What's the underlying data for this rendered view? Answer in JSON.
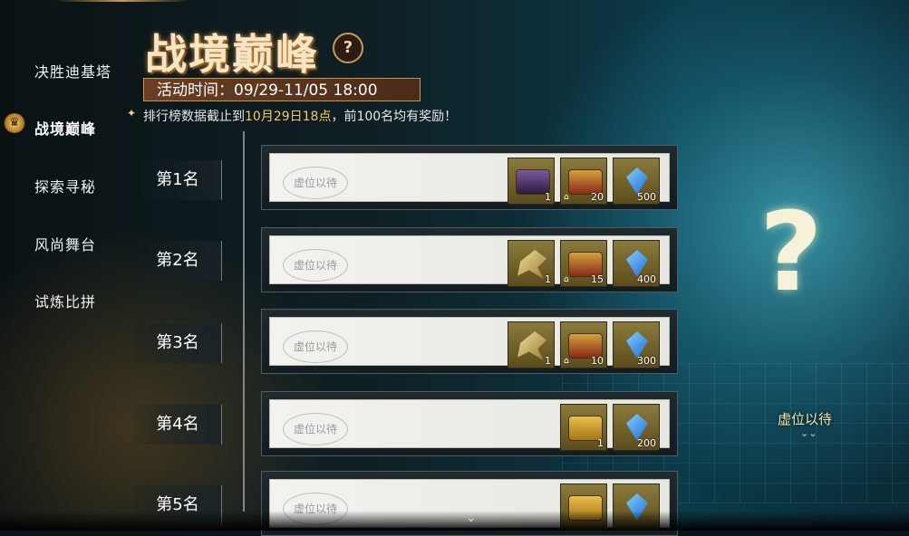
{
  "nav": {
    "items": [
      {
        "label": "决胜迪基塔",
        "active": false
      },
      {
        "label": "战境巅峰",
        "active": true
      },
      {
        "label": "探索寻秘",
        "active": false
      },
      {
        "label": "风尚舞台",
        "active": false
      },
      {
        "label": "试炼比拼",
        "active": false
      }
    ]
  },
  "header": {
    "title": "战境巅峰",
    "help": "?",
    "time": "活动时间：09/29-11/05 18:00",
    "notice_pre": "排行榜数据截止到",
    "notice_highlight": "10月29日18点",
    "notice_post": "，前100名均有奖励！"
  },
  "rankings": [
    {
      "label": "第1名",
      "placeholder": "虚位以待",
      "rewards": [
        {
          "icon": "dark-chest-icon",
          "qty": "1"
        },
        {
          "icon": "gold-chest-icon",
          "qty": "20"
        },
        {
          "icon": "blue-gem-icon",
          "qty": "500"
        }
      ]
    },
    {
      "label": "第2名",
      "placeholder": "虚位以待",
      "rewards": [
        {
          "icon": "weapon-icon",
          "qty": "1"
        },
        {
          "icon": "gold-chest-icon",
          "qty": "15"
        },
        {
          "icon": "blue-gem-icon",
          "qty": "400"
        }
      ]
    },
    {
      "label": "第3名",
      "placeholder": "虚位以待",
      "rewards": [
        {
          "icon": "weapon-icon",
          "qty": "1"
        },
        {
          "icon": "gold-chest-icon",
          "qty": "10"
        },
        {
          "icon": "blue-gem-icon",
          "qty": "300"
        }
      ]
    },
    {
      "label": "第4名",
      "placeholder": "虚位以待",
      "rewards": [
        {
          "icon": "treasure-chest-icon",
          "qty": "1"
        },
        {
          "icon": "blue-gem-icon",
          "qty": "200"
        }
      ]
    },
    {
      "label": "第5名",
      "placeholder": "虚位以待",
      "rewards": [
        {
          "icon": "treasure-chest-icon",
          "qty": ""
        },
        {
          "icon": "blue-gem-icon",
          "qty": ""
        }
      ]
    }
  ],
  "preview": {
    "mark": "?",
    "label": "虚位以待"
  }
}
